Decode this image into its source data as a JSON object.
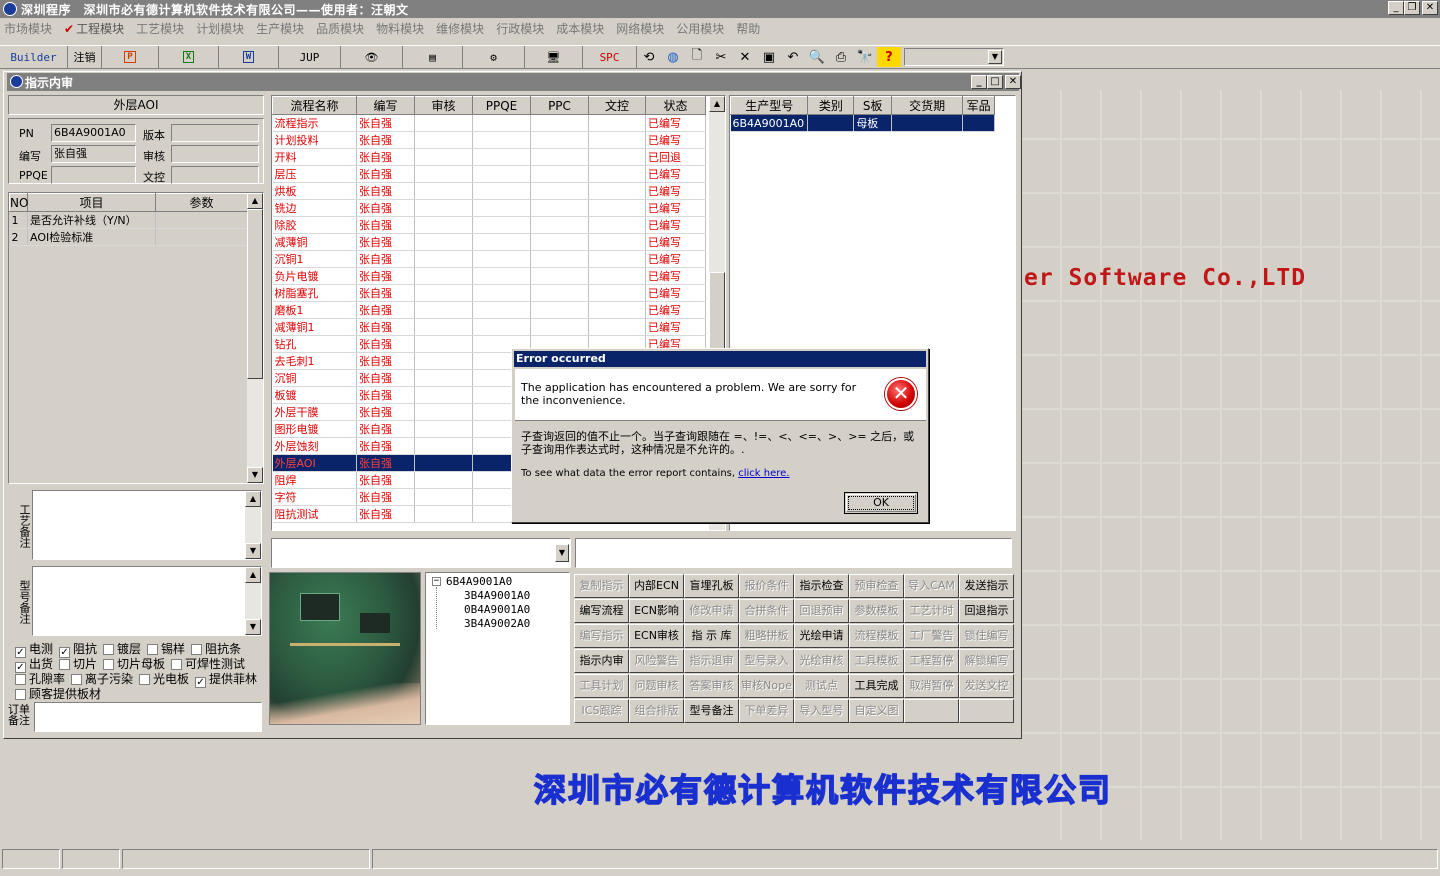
{
  "app": {
    "title": "深圳程序　深圳市必有德计算机软件技术有限公司——使用者：汪朝文"
  },
  "menu": [
    "市场模块",
    "工程模块",
    "工艺模块",
    "计划模块",
    "生产模块",
    "品质模块",
    "物料模块",
    "维修模块",
    "行政模块",
    "成本模块",
    "网络模块",
    "公用模块",
    "帮助"
  ],
  "toolbar": {
    "builder": "Builder",
    "logout": "注销",
    "jup": "JUP",
    "spc": "SPC"
  },
  "background": {
    "logo_text": "er Software Co.,LTD",
    "company_cn": "深圳市必有德计算机软件技术有限公司"
  },
  "window": {
    "title": "指示内审"
  },
  "left_panel": {
    "section_title": "外层AOI",
    "pn_label": "PN",
    "pn_value": "6B4A9001A0",
    "version_label": "版本",
    "version_value": "",
    "editor_label": "编写",
    "editor_value": "张自强",
    "review_label": "审核",
    "review_value": "",
    "ppqe_label": "PPQE",
    "ppqe_value": "",
    "doc_label": "文控",
    "doc_value": "",
    "params_headers": [
      "NO",
      "项目",
      "参数"
    ],
    "params_rows": [
      {
        "no": "1",
        "item": "是否允许补线（Y/N）",
        "param": ""
      },
      {
        "no": "2",
        "item": "AOI检验标准",
        "param": ""
      }
    ],
    "process_note_label": "工艺备注",
    "model_note_label": "型号备注",
    "order_note_label": "订单备注",
    "checkboxes_row1": [
      {
        "label": "电测",
        "checked": true
      },
      {
        "label": "阻抗",
        "checked": true
      },
      {
        "label": "镀层",
        "checked": false
      },
      {
        "label": "锡样",
        "checked": false
      },
      {
        "label": "阻抗条",
        "checked": false
      }
    ],
    "checkboxes_row2": [
      {
        "label": "出货",
        "checked": true
      },
      {
        "label": "切片",
        "checked": false
      },
      {
        "label": "切片母板",
        "checked": false
      },
      {
        "label": "可焊性测试",
        "checked": false
      }
    ],
    "checkboxes_row3": [
      {
        "label": "孔隙率",
        "checked": false
      },
      {
        "label": "离子污染",
        "checked": false
      },
      {
        "label": "光电板",
        "checked": false
      },
      {
        "label": "提供菲林",
        "checked": true
      }
    ],
    "checkboxes_row4": [
      {
        "label": "顾客提供板材",
        "checked": false
      }
    ]
  },
  "process_table": {
    "headers": [
      "流程名称",
      "编写",
      "审核",
      "PPQE",
      "PPC",
      "文控",
      "状态"
    ],
    "rows": [
      {
        "name": "流程指示",
        "author": "张自强",
        "status": "已编写"
      },
      {
        "name": "计划投料",
        "author": "张自强",
        "status": "已编写"
      },
      {
        "name": "开料",
        "author": "张自强",
        "status": "已回退"
      },
      {
        "name": "层压",
        "author": "张自强",
        "status": "已编写"
      },
      {
        "name": "烘板",
        "author": "张自强",
        "status": "已编写"
      },
      {
        "name": "铣边",
        "author": "张自强",
        "status": "已编写"
      },
      {
        "name": "除胶",
        "author": "张自强",
        "status": "已编写"
      },
      {
        "name": "减薄铜",
        "author": "张自强",
        "status": "已编写"
      },
      {
        "name": "沉铜1",
        "author": "张自强",
        "status": "已编写"
      },
      {
        "name": "负片电镀",
        "author": "张自强",
        "status": "已编写"
      },
      {
        "name": "树脂塞孔",
        "author": "张自强",
        "status": "已编写"
      },
      {
        "name": "磨板1",
        "author": "张自强",
        "status": "已编写"
      },
      {
        "name": "减薄铜1",
        "author": "张自强",
        "status": "已编写"
      },
      {
        "name": "钻孔",
        "author": "张自强",
        "status": "已编写"
      },
      {
        "name": "去毛刺1",
        "author": "张自强",
        "status": ""
      },
      {
        "name": "沉铜",
        "author": "张自强",
        "status": ""
      },
      {
        "name": "板镀",
        "author": "张自强",
        "status": ""
      },
      {
        "name": "外层干膜",
        "author": "张自强",
        "status": ""
      },
      {
        "name": "图形电镀",
        "author": "张自强",
        "status": ""
      },
      {
        "name": "外层蚀刻",
        "author": "张自强",
        "status": ""
      },
      {
        "name": "外层AOI",
        "author": "张自强",
        "status": "",
        "selected": true
      },
      {
        "name": "阻焊",
        "author": "张自强",
        "status": ""
      },
      {
        "name": "字符",
        "author": "张自强",
        "status": ""
      },
      {
        "name": "阻抗测试",
        "author": "张自强",
        "status": ""
      }
    ]
  },
  "model_table": {
    "headers": [
      "生产型号",
      "类别",
      "S板",
      "交货期",
      "军品"
    ],
    "rows": [
      {
        "model": "6B4A9001A0",
        "category": "",
        "sboard": "母板",
        "delivery": "",
        "military": ""
      }
    ]
  },
  "tree": {
    "root": "6B4A9001A0",
    "children": [
      "3B4A9001A0",
      "0B4A9001A0",
      "3B4A9002A0"
    ]
  },
  "func_buttons": [
    [
      {
        "t": "复制指示",
        "d": true
      },
      {
        "t": "内部ECN",
        "d": false
      },
      {
        "t": "盲埋孔板",
        "d": false
      },
      {
        "t": "报价条件",
        "d": true
      },
      {
        "t": "指示检查",
        "d": false
      },
      {
        "t": "预审检查",
        "d": true
      },
      {
        "t": "导入CAM",
        "d": true
      },
      {
        "t": "发送指示",
        "d": false
      }
    ],
    [
      {
        "t": "编写流程",
        "d": false
      },
      {
        "t": "ECN影响",
        "d": false
      },
      {
        "t": "修改申请",
        "d": true
      },
      {
        "t": "合拼条件",
        "d": true
      },
      {
        "t": "回退预审",
        "d": true
      },
      {
        "t": "参数模板",
        "d": true
      },
      {
        "t": "工艺计时",
        "d": true
      },
      {
        "t": "回退指示",
        "d": false
      }
    ],
    [
      {
        "t": "编写指示",
        "d": true
      },
      {
        "t": "ECN审核",
        "d": false
      },
      {
        "t": "指 示 库",
        "d": false
      },
      {
        "t": "粗略拼板",
        "d": true
      },
      {
        "t": "光绘申请",
        "d": false
      },
      {
        "t": "流程模板",
        "d": true
      },
      {
        "t": "工厂警告",
        "d": true
      },
      {
        "t": "锁住编写",
        "d": true
      }
    ],
    [
      {
        "t": "指示内审",
        "d": false
      },
      {
        "t": "风险警告",
        "d": true
      },
      {
        "t": "指示退审",
        "d": true
      },
      {
        "t": "型号录入",
        "d": true
      },
      {
        "t": "光绘审核",
        "d": true
      },
      {
        "t": "工具模板",
        "d": true
      },
      {
        "t": "工程暂停",
        "d": true
      },
      {
        "t": "解锁编写",
        "d": true
      }
    ],
    [
      {
        "t": "工具计划",
        "d": true
      },
      {
        "t": "问题审核",
        "d": true
      },
      {
        "t": "答案审核",
        "d": true
      },
      {
        "t": "审核Nope",
        "d": true
      },
      {
        "t": "测试点",
        "d": true
      },
      {
        "t": "工具完成",
        "d": false
      },
      {
        "t": "取消暂停",
        "d": true
      },
      {
        "t": "发送文控",
        "d": true
      }
    ],
    [
      {
        "t": "ICS跟踪",
        "d": true
      },
      {
        "t": "组合排版",
        "d": true
      },
      {
        "t": "型号备注",
        "d": false
      },
      {
        "t": "下单差异",
        "d": true
      },
      {
        "t": "导入型号",
        "d": true
      },
      {
        "t": "自定义图",
        "d": true
      },
      {
        "t": "",
        "d": true
      },
      {
        "t": "",
        "d": true
      }
    ]
  ],
  "dialog": {
    "title": "Error occurred",
    "headline": "The application has encountered a problem. We are sorry for the inconvenience.",
    "message": "子查询返回的值不止一个。当子查询跟随在 =、!=、<、<=、>、>= 之后，或子查询用作表达式时，这种情况是不允许的。.",
    "report_text": "To see what data the error report contains,",
    "report_link": "click here.",
    "ok_label": "OK"
  }
}
